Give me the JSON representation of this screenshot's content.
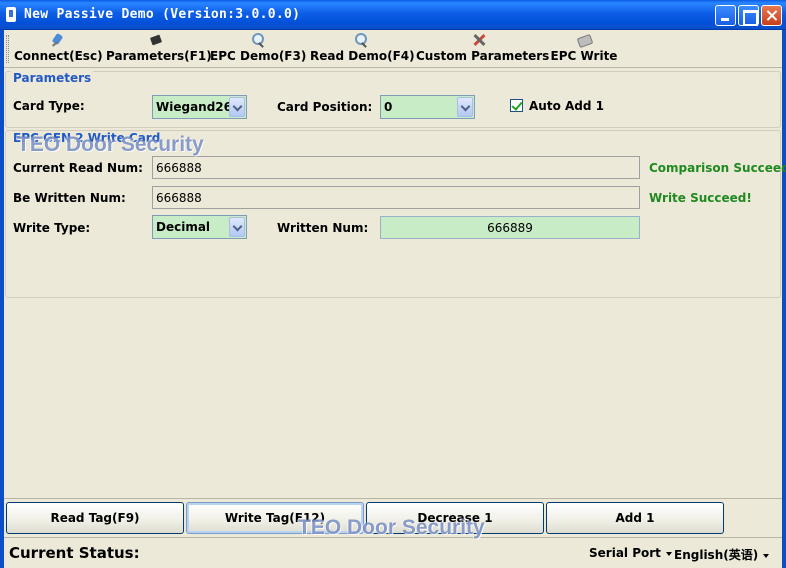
{
  "window": {
    "title": "New Passive Demo (Version:3.0.0.0)"
  },
  "toolbar": {
    "items": [
      {
        "label": "Connect(Esc)",
        "icon": "plug-icon"
      },
      {
        "label": "Parameters(F1)",
        "icon": "chip-icon"
      },
      {
        "label": "EPC Demo(F3)",
        "icon": "magnifier-icon"
      },
      {
        "label": "Read Demo(F4)",
        "icon": "magnifier-icon"
      },
      {
        "label": "Custom Parameters",
        "icon": "tools-icon"
      },
      {
        "label": "EPC Write",
        "icon": "tag-icon"
      }
    ]
  },
  "parameters": {
    "legend": "Parameters",
    "card_type_label": "Card Type:",
    "card_type_value": "Wiegand26",
    "card_position_label": "Card Position:",
    "card_position_value": "0",
    "auto_add_label": "Auto Add 1",
    "auto_add_checked": true
  },
  "write_card": {
    "legend": "EPC GEN 2 Write Card",
    "current_read_label": "Current Read Num:",
    "current_read_value": "666888",
    "comparison_status": "Comparison Succeed!",
    "be_written_label": "Be Written Num:",
    "be_written_value": "666888",
    "write_status": "Write Succeed!",
    "write_type_label": "Write Type:",
    "write_type_value": "Decimal",
    "written_num_label": "Written Num:",
    "written_num_value": "666889"
  },
  "buttons": {
    "read_tag": "Read Tag(F9)",
    "write_tag": "Write Tag(F12)",
    "decrease": "Decrease 1",
    "add": "Add 1"
  },
  "status": {
    "label": "Current Status:",
    "serial_port": "Serial Port",
    "language": "English(英语)"
  },
  "watermark": "TEO Door Security",
  "colors": {
    "title_bar": "#0a5ce4",
    "legend_blue": "#2159c6",
    "success_green": "#1f8a1f",
    "field_green": "#c8ecc6"
  }
}
